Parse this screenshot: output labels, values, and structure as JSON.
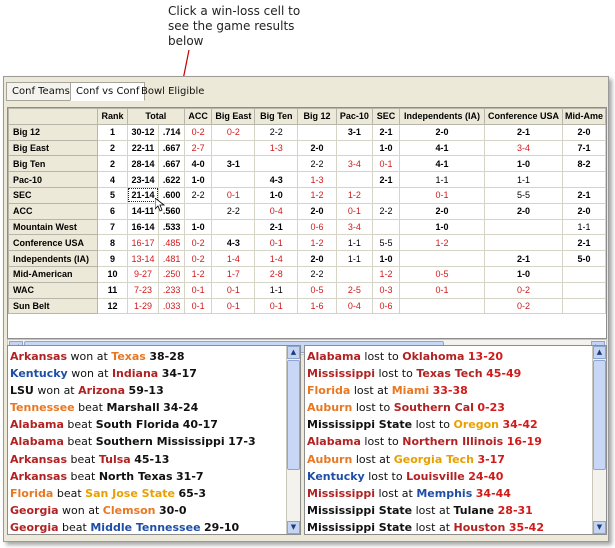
{
  "callout": {
    "text": "Click a win-loss cell to see the game results below"
  },
  "tabs": [
    {
      "label": "Conf Teams",
      "state": "normal"
    },
    {
      "label": "Conf vs Conf",
      "state": "active"
    },
    {
      "label": "Bowl Eligible",
      "state": "plain"
    }
  ],
  "grid": {
    "columns": [
      "Rank",
      "Total",
      "ACC",
      "Big East",
      "Big Ten",
      "Big 12",
      "Pac-10",
      "SEC",
      "Independents (IA)",
      "Conference USA",
      "Mid-Ame"
    ],
    "rows": [
      {
        "name": "Big 12",
        "rank": "1",
        "total": "30-12",
        "pct": ".714",
        "cells": [
          "0-2",
          "0-2",
          "2-2",
          "",
          "3-1",
          "2-1",
          "2-0",
          "2-1",
          "2-0"
        ]
      },
      {
        "name": "Big East",
        "rank": "2",
        "total": "22-11",
        "pct": ".667",
        "cells": [
          "2-7",
          "",
          "1-3",
          "2-0",
          "",
          "1-0",
          "4-1",
          "3-4",
          "7-1"
        ]
      },
      {
        "name": "Big Ten",
        "rank": "2",
        "total": "28-14",
        "pct": ".667",
        "cells": [
          "4-0",
          "3-1",
          "",
          "2-2",
          "3-4",
          "0-1",
          "4-1",
          "1-0",
          "8-2"
        ]
      },
      {
        "name": "Pac-10",
        "rank": "4",
        "total": "23-14",
        "pct": ".622",
        "cells": [
          "1-0",
          "",
          "4-3",
          "1-3",
          "",
          "2-1",
          "1-1",
          "1-1",
          ""
        ]
      },
      {
        "name": "SEC",
        "rank": "5",
        "total": "21-14",
        "pct": ".600",
        "cells": [
          "2-2",
          "0-1",
          "1-0",
          "1-2",
          "1-2",
          "",
          "0-1",
          "5-5",
          "2-1"
        ]
      },
      {
        "name": "ACC",
        "rank": "6",
        "total": "14-11",
        "pct": ".560",
        "cells": [
          "",
          "2-2",
          "0-4",
          "2-0",
          "0-1",
          "2-2",
          "2-0",
          "2-0",
          "2-0"
        ]
      },
      {
        "name": "Mountain West",
        "rank": "7",
        "total": "16-14",
        "pct": ".533",
        "cells": [
          "1-0",
          "",
          "2-1",
          "0-6",
          "3-4",
          "",
          "1-0",
          "",
          "1-1"
        ]
      },
      {
        "name": "Conference USA",
        "rank": "8",
        "total": "16-17",
        "pct": ".485",
        "cells": [
          "0-2",
          "4-3",
          "0-1",
          "1-2",
          "1-1",
          "5-5",
          "1-2",
          "",
          "2-1"
        ]
      },
      {
        "name": "Independents (IA)",
        "rank": "9",
        "total": "13-14",
        "pct": ".481",
        "cells": [
          "0-2",
          "1-4",
          "1-4",
          "2-0",
          "1-1",
          "1-0",
          "",
          "2-1",
          "5-0"
        ]
      },
      {
        "name": "Mid-American",
        "rank": "10",
        "total": "9-27",
        "pct": ".250",
        "cells": [
          "1-2",
          "1-7",
          "2-8",
          "2-2",
          "",
          "1-2",
          "0-5",
          "1-0",
          ""
        ]
      },
      {
        "name": "WAC",
        "rank": "11",
        "total": "7-23",
        "pct": ".233",
        "cells": [
          "0-1",
          "0-1",
          "1-1",
          "0-5",
          "2-5",
          "0-3",
          "0-1",
          "0-2",
          ""
        ]
      },
      {
        "name": "Sun Belt",
        "rank": "12",
        "total": "1-29",
        "pct": ".033",
        "cells": [
          "0-1",
          "0-1",
          "0-1",
          "1-6",
          "0-4",
          "0-6",
          "",
          "0-2",
          ""
        ]
      }
    ],
    "selected_row": 4
  },
  "games_left": [
    {
      "a": "Arkansas",
      "a_color": "#b22222",
      "verb": "won at",
      "b": "Texas",
      "b_color": "#e87722",
      "score": "38-28"
    },
    {
      "a": "Kentucky",
      "a_color": "#1f4ea6",
      "verb": "won at",
      "b": "Indiana",
      "b_color": "#b22222",
      "score": "34-17"
    },
    {
      "a": "LSU",
      "a_color": "#111111",
      "verb": "won at",
      "b": "Arizona",
      "b_color": "#b22222",
      "score": "59-13"
    },
    {
      "a": "Tennessee",
      "a_color": "#e87722",
      "verb": "beat",
      "b": "Marshall",
      "b_color": "#111111",
      "score": "34-24"
    },
    {
      "a": "Alabama",
      "a_color": "#b22222",
      "verb": "beat",
      "b": "South Florida",
      "b_color": "#111111",
      "score": "40-17"
    },
    {
      "a": "Alabama",
      "a_color": "#b22222",
      "verb": "beat",
      "b": "Southern Mississippi",
      "b_color": "#111111",
      "score": "17-3"
    },
    {
      "a": "Arkansas",
      "a_color": "#b22222",
      "verb": "beat",
      "b": "Tulsa",
      "b_color": "#b22222",
      "score": "45-13"
    },
    {
      "a": "Arkansas",
      "a_color": "#b22222",
      "verb": "beat",
      "b": "North Texas",
      "b_color": "#111111",
      "score": "31-7"
    },
    {
      "a": "Florida",
      "a_color": "#e87722",
      "verb": "beat",
      "b": "San Jose State",
      "b_color": "#e8a000",
      "score": "65-3"
    },
    {
      "a": "Georgia",
      "a_color": "#b22222",
      "verb": "won at",
      "b": "Clemson",
      "b_color": "#e87722",
      "score": "30-0"
    },
    {
      "a": "Georgia",
      "a_color": "#b22222",
      "verb": "beat",
      "b": "Middle Tennessee",
      "b_color": "#1f4ea6",
      "score": "29-10"
    }
  ],
  "games_right": [
    {
      "a": "Alabama",
      "a_color": "#b22222",
      "verb": "lost to",
      "b": "Oklahoma",
      "b_color": "#b22222",
      "score": "13-20"
    },
    {
      "a": "Mississippi",
      "a_color": "#b22222",
      "verb": "lost to",
      "b": "Texas Tech",
      "b_color": "#b22222",
      "score": "45-49"
    },
    {
      "a": "Florida",
      "a_color": "#e87722",
      "verb": "lost at",
      "b": "Miami",
      "b_color": "#e87722",
      "score": "33-38"
    },
    {
      "a": "Auburn",
      "a_color": "#e87722",
      "verb": "lost to",
      "b": "Southern Cal",
      "b_color": "#b22222",
      "score": "0-23"
    },
    {
      "a": "Mississippi State",
      "a_color": "#111111",
      "verb": "lost to",
      "b": "Oregon",
      "b_color": "#e8a000",
      "score": "34-42"
    },
    {
      "a": "Alabama",
      "a_color": "#b22222",
      "verb": "lost to",
      "b": "Northern Illinois",
      "b_color": "#b22222",
      "score": "16-19"
    },
    {
      "a": "Auburn",
      "a_color": "#e87722",
      "verb": "lost at",
      "b": "Georgia Tech",
      "b_color": "#e8a000",
      "score": "3-17"
    },
    {
      "a": "Kentucky",
      "a_color": "#1f4ea6",
      "verb": "lost to",
      "b": "Louisville",
      "b_color": "#b22222",
      "score": "24-40"
    },
    {
      "a": "Mississippi",
      "a_color": "#b22222",
      "verb": "lost at",
      "b": "Memphis",
      "b_color": "#1f4ea6",
      "score": "34-44"
    },
    {
      "a": "Mississippi State",
      "a_color": "#111111",
      "verb": "lost at",
      "b": "Tulane",
      "b_color": "#111111",
      "score": "28-31"
    },
    {
      "a": "Mississippi State",
      "a_color": "#111111",
      "verb": "lost at",
      "b": "Houston",
      "b_color": "#b22222",
      "score": "35-42"
    }
  ],
  "colors": {
    "loss": "#d11a1a",
    "win": "#000000",
    "grid_header": "#ece9d8"
  }
}
